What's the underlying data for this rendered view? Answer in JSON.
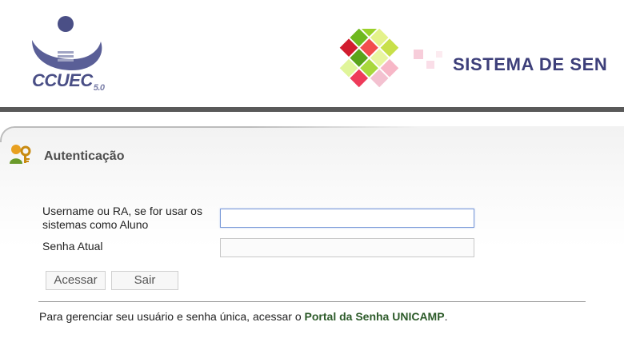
{
  "header": {
    "logo_text": "CCUEC",
    "logo_version": "5.0",
    "system_title": "SISTEMA DE SEN"
  },
  "panel": {
    "title": "Autenticação",
    "icon": "user-key-icon"
  },
  "form": {
    "username_label": "Username ou RA, se for usar os sistemas como Aluno",
    "username_value": "",
    "password_label": "Senha Atual",
    "password_value": "",
    "submit_label": "Acessar",
    "exit_label": "Sair"
  },
  "footer": {
    "text_before": "Para gerenciar seu usuário e senha única, acessar o ",
    "link_text": "Portal da Senha UNICAMP",
    "text_after": "."
  },
  "colors": {
    "brand_blue": "#4a4f86",
    "header_bar": "#595959",
    "link_green": "#2d5b2a",
    "focus_border": "#7a9ad8"
  }
}
